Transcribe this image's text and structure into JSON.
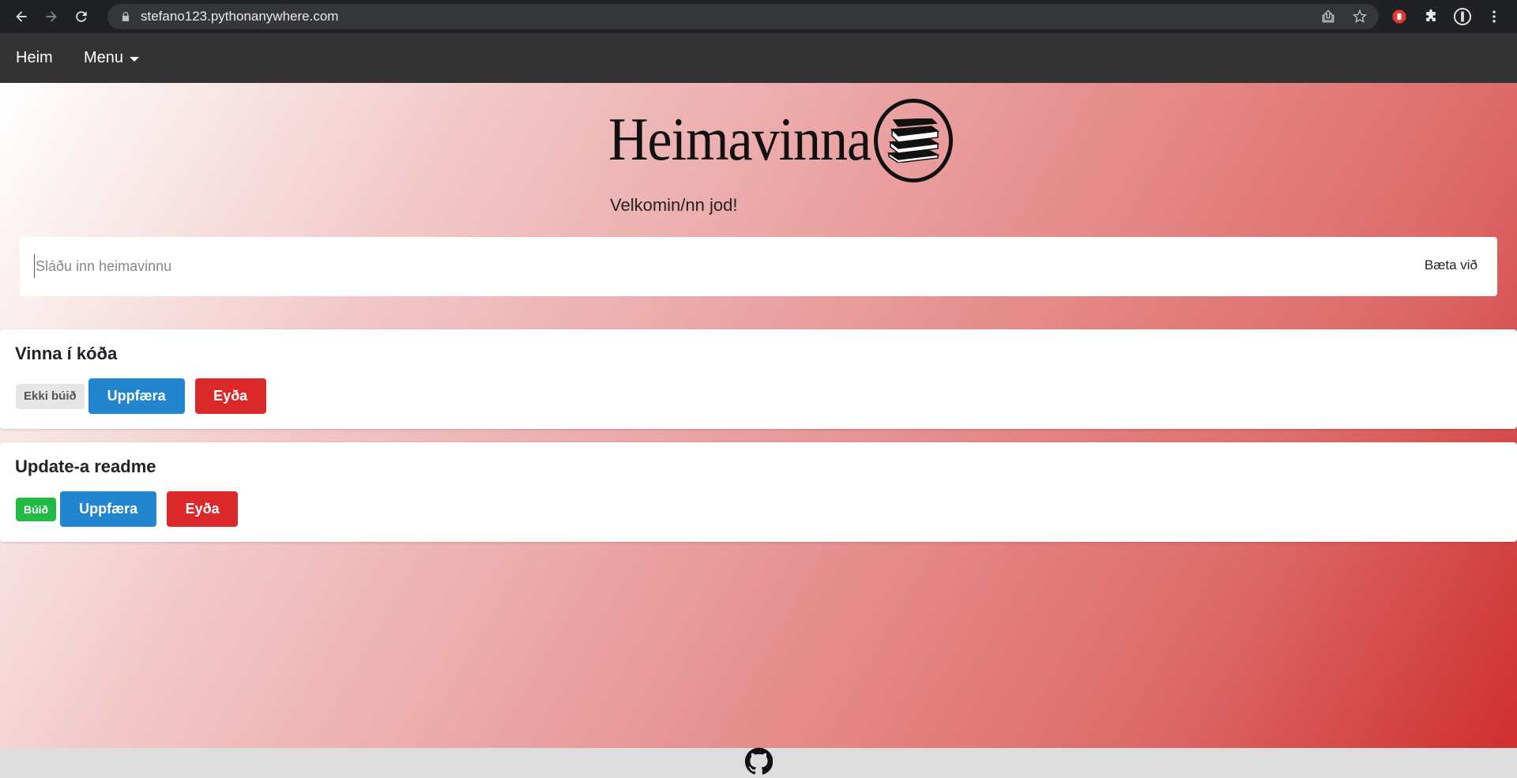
{
  "browser": {
    "url": "stefano123.pythonanywhere.com"
  },
  "nav": {
    "home": "Heim",
    "menu": "Menu"
  },
  "header": {
    "logo_text": "Heimavinna",
    "welcome": "Velkomin/nn jod!"
  },
  "form": {
    "placeholder": "Sláðu inn heimavinnu",
    "add_label": "Bæta við"
  },
  "tasks": [
    {
      "title": "Vinna í kóða",
      "status": "Ekki búið",
      "update_label": "Uppfæra",
      "delete_label": "Eyða"
    },
    {
      "title": "Update-a readme",
      "status": "Búið",
      "update_label": "Uppfæra",
      "delete_label": "Eyða"
    }
  ],
  "colors": {
    "update": "#2185d0",
    "delete": "#db2828",
    "done": "#21ba45",
    "nav_bg": "#333333"
  },
  "icons": {
    "footer": "github-icon",
    "logo": "books-icon"
  }
}
